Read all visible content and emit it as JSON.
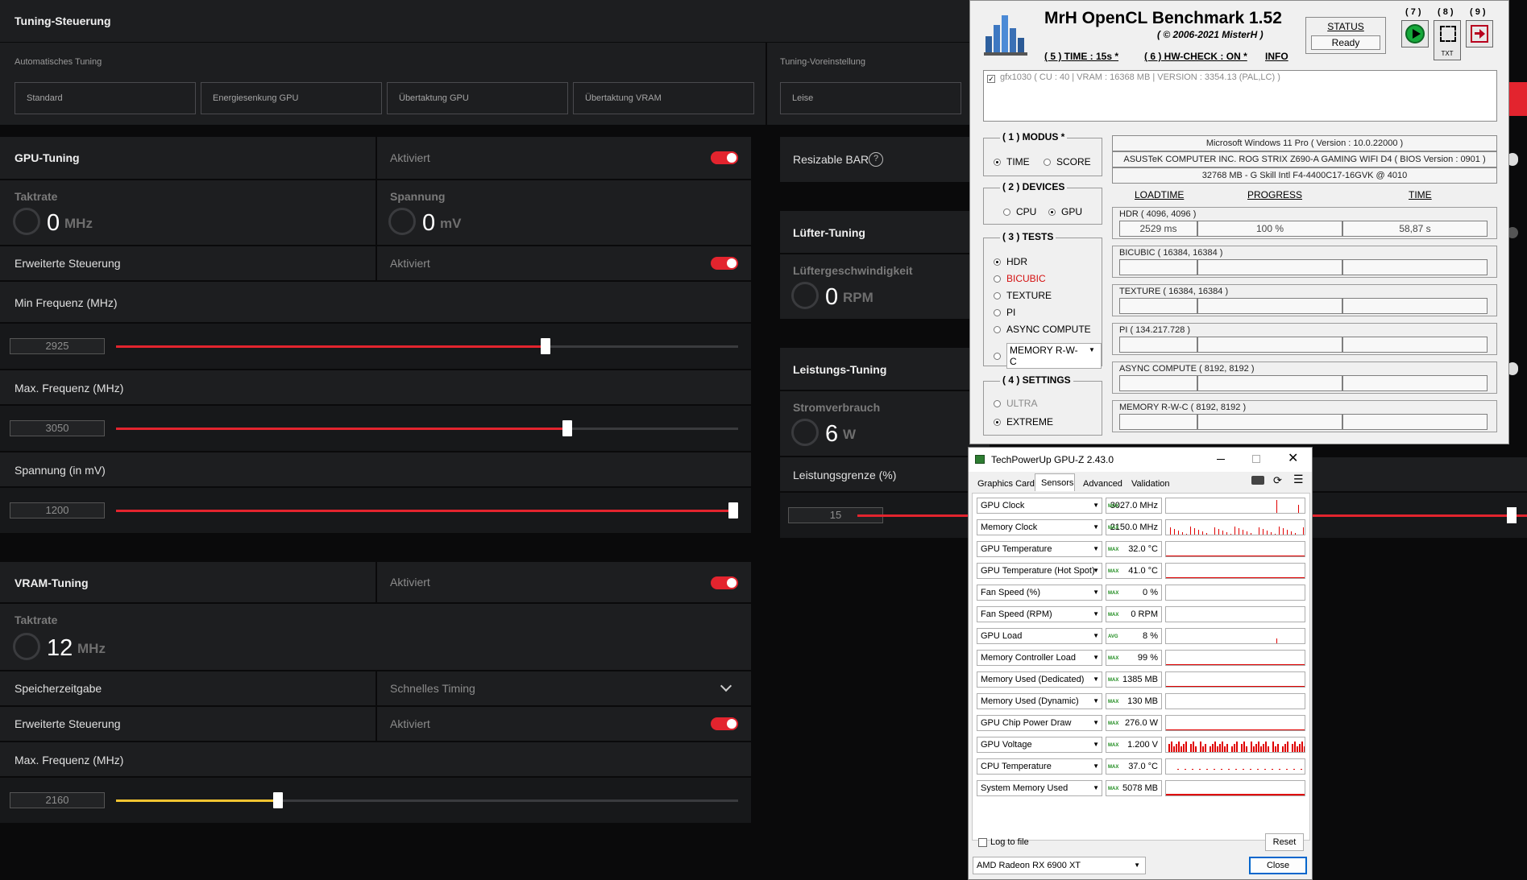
{
  "adrenalin": {
    "tuning_title": "Tuning-Steuerung",
    "auto_tuning_label": "Automatisches Tuning",
    "auto_buttons": [
      "Standard",
      "Energiesenkung GPU",
      "Übertaktung GPU",
      "Übertaktung VRAM"
    ],
    "preset_label": "Tuning-Voreinstellung",
    "preset_button": "Leise",
    "gpu_tuning": {
      "title": "GPU-Tuning",
      "status": "Aktiviert",
      "clock_label": "Taktrate",
      "clock_value": "0",
      "clock_unit": "MHz",
      "voltage_label": "Spannung",
      "voltage_value": "0",
      "voltage_unit": "mV",
      "advanced_label": "Erweiterte Steuerung",
      "advanced_status": "Aktiviert",
      "min_freq_label": "Min Frequenz (MHz)",
      "min_freq_value": "2925",
      "min_freq_fraction": 0.69,
      "max_freq_label": "Max. Frequenz (MHz)",
      "max_freq_value": "3050",
      "max_freq_fraction": 0.725,
      "voltage_slider_label": "Spannung (in mV)",
      "voltage_slider_value": "1200",
      "voltage_slider_fraction": 1.0
    },
    "vram_tuning": {
      "title": "VRAM-Tuning",
      "status": "Aktiviert",
      "clock_label": "Taktrate",
      "clock_value": "12",
      "clock_unit": "MHz",
      "timing_label": "Speicherzeitgabe",
      "timing_value": "Schnelles Timing",
      "advanced_label": "Erweiterte Steuerung",
      "advanced_status": "Aktiviert",
      "max_freq_label": "Max. Frequenz (MHz)",
      "max_freq_value": "2160",
      "max_freq_fraction": 0.26
    },
    "resizable_bar": "Resizable BAR",
    "fan_tuning": {
      "title": "Lüfter-Tuning",
      "speed_label": "Lüftergeschwindigkeit",
      "speed_value": "0",
      "speed_unit": "RPM"
    },
    "power_tuning": {
      "title": "Leistungs-Tuning",
      "consumption_label": "Stromverbrauch",
      "consumption_value": "6",
      "consumption_unit": "W",
      "limit_label": "Leistungsgrenze (%)",
      "limit_value": "15",
      "limit_fraction": 1.0
    },
    "accent_red": "#e3242e",
    "accent_yellow": "#f2c431"
  },
  "opencl": {
    "title": "MrH OpenCL Benchmark 1.52",
    "copyright": "( © 2006-2021 MisterH )",
    "time_link": "( 5 ) TIME : 15s *",
    "hwcheck_link": "( 6 ) HW-CHECK : ON *",
    "info_link": "INFO",
    "status_label": "STATUS",
    "status_value": "Ready",
    "btn7": "( 7 )",
    "btn8": "( 8 )",
    "btn9": "( 9 )",
    "txt_label": "TXT",
    "device_line": "gfx1030 ( CU : 40 | VRAM : 16368 MB | VERSION : 3354.13 (PAL,LC) )",
    "modus_title": "( 1 ) MODUS *",
    "modus_options": [
      "TIME",
      "SCORE"
    ],
    "devices_title": "( 2 ) DEVICES",
    "devices_options": [
      "CPU",
      "GPU"
    ],
    "tests_title": "( 3 ) TESTS",
    "tests_options": [
      "HDR",
      "BICUBIC",
      "TEXTURE",
      "PI",
      "ASYNC COMPUTE",
      "MEMORY R-W-C"
    ],
    "settings_title": "( 4 ) SETTINGS",
    "settings_options": [
      "ULTRA",
      "EXTREME"
    ],
    "sys_os": "Microsoft Windows 11 Pro ( Version : 10.0.22000 )",
    "sys_board": "ASUSTeK COMPUTER INC. ROG STRIX Z690-A GAMING WIFI D4 ( BIOS Version : 0901 )",
    "sys_mem": "32768 MB - G Skill Intl F4-4400C17-16GVK     @ 4010",
    "col_loadtime": "LOADTIME",
    "col_progress": "PROGRESS",
    "col_time": "TIME",
    "tests": [
      {
        "name": "HDR ( 4096, 4096 )",
        "loadtime": "2529 ms",
        "progress": "100 %",
        "time": "58,87  s"
      },
      {
        "name": "BICUBIC ( 16384, 16384 )",
        "loadtime": "",
        "progress": "",
        "time": ""
      },
      {
        "name": "TEXTURE ( 16384, 16384 )",
        "loadtime": "",
        "progress": "",
        "time": ""
      },
      {
        "name": "PI ( 134.217.728 )",
        "loadtime": "",
        "progress": "",
        "time": ""
      },
      {
        "name": "ASYNC COMPUTE ( 8192, 8192 )",
        "loadtime": "",
        "progress": "",
        "time": ""
      },
      {
        "name": "MEMORY R-W-C ( 8192, 8192 )",
        "loadtime": "",
        "progress": "",
        "time": ""
      }
    ]
  },
  "gpuz": {
    "title": "TechPowerUp GPU-Z 2.43.0",
    "tabs": [
      "Graphics Card",
      "Sensors",
      "Advanced",
      "Validation"
    ],
    "sensors": [
      {
        "name": "GPU Clock",
        "tag": "MAX",
        "value": "3027.0 MHz"
      },
      {
        "name": "Memory Clock",
        "tag": "MAX",
        "value": "2150.0 MHz"
      },
      {
        "name": "GPU Temperature",
        "tag": "MAX",
        "value": "32.0 °C"
      },
      {
        "name": "GPU Temperature (Hot Spot)",
        "tag": "MAX",
        "value": "41.0 °C"
      },
      {
        "name": "Fan Speed (%)",
        "tag": "MAX",
        "value": "0 %"
      },
      {
        "name": "Fan Speed (RPM)",
        "tag": "MAX",
        "value": "0 RPM"
      },
      {
        "name": "GPU Load",
        "tag": "AVG",
        "value": "8 %"
      },
      {
        "name": "Memory Controller Load",
        "tag": "MAX",
        "value": "99 %"
      },
      {
        "name": "Memory Used (Dedicated)",
        "tag": "MAX",
        "value": "1385 MB"
      },
      {
        "name": "Memory Used (Dynamic)",
        "tag": "MAX",
        "value": "130 MB"
      },
      {
        "name": "GPU Chip Power Draw",
        "tag": "MAX",
        "value": "276.0 W"
      },
      {
        "name": "GPU Voltage",
        "tag": "MAX",
        "value": "1.200 V"
      },
      {
        "name": "CPU Temperature",
        "tag": "MAX",
        "value": "37.0 °C"
      },
      {
        "name": "System Memory Used",
        "tag": "MAX",
        "value": "5078 MB"
      }
    ],
    "log_label": "Log to file",
    "reset_label": "Reset",
    "gpu_select": "AMD Radeon RX 6900 XT",
    "close_label": "Close"
  }
}
